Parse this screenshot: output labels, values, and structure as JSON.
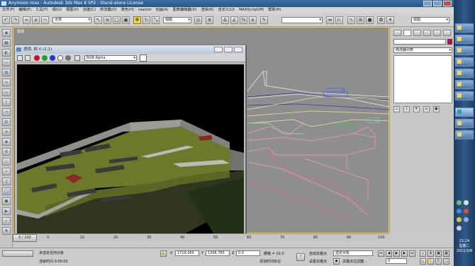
{
  "window": {
    "title": "Anymoon.max - Autodesk 3ds Max 8 SP2 - Stand-alone License"
  },
  "menu": [
    "文件(F)",
    "编辑(E)",
    "工具(T)",
    "组(G)",
    "视图(V)",
    "创建(C)",
    "修改器(O)",
    "角色(H)",
    "reactor",
    "动画(A)",
    "图表编辑器(D)",
    "渲染(R)",
    "自定义(U)",
    "MAXScript(M)",
    "帮助(H)"
  ],
  "toolbar": {
    "selection_filter": "全部",
    "ref_coord": "视图",
    "named_selection": "",
    "right_dropdown": "视图"
  },
  "viewport": {
    "label": "透视"
  },
  "render_window": {
    "title": "透视, 帧 0 (1:1)",
    "channel": "RGB Alpha"
  },
  "command_panel": {
    "object_name": "",
    "modifier_list": "修改器列表",
    "object_color": "#a5174a"
  },
  "timeline": {
    "slider": "0 / 100",
    "ticks": [
      "0",
      "10",
      "20",
      "30",
      "40",
      "50",
      "60",
      "70",
      "80",
      "90",
      "100"
    ]
  },
  "status": {
    "selection": "未选定任何对象",
    "prompt": "渲染时间 0:00:02",
    "x_label": "X",
    "x_value": "1719.065",
    "y_label": "Y",
    "y_value": "1306.765",
    "z_label": "Z",
    "z_value": "0.0",
    "grid": "栅格 = 10.0",
    "add_time_tag": "添加时间标记",
    "auto_key": "自动关键点",
    "set_key": "设置关键点",
    "key_mode": "选定对象",
    "key_filters": "关键点过滤器...",
    "frame": "0"
  },
  "taskbar": {
    "clock_time": "21:24",
    "clock_day": "星期二",
    "clock_date": "2011/3/8"
  }
}
